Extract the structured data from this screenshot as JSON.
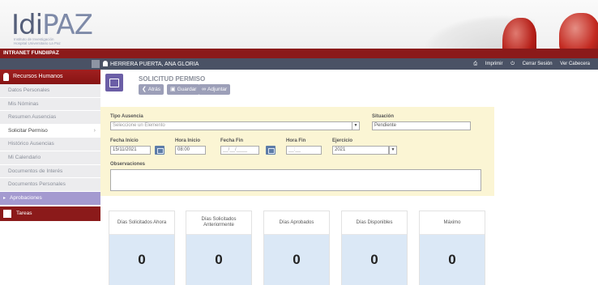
{
  "header": {
    "logo_main": "Idi",
    "logo_accent": "PAZ",
    "logo_subtitle_1": "Instituto de Investigación",
    "logo_subtitle_2": "Hospital Universitario La Paz"
  },
  "topbar": {
    "title": "INTRANET FUNDIIPAZ"
  },
  "userbar": {
    "user_name": "HERRERA PUERTA, ANA GLORIA",
    "print": "Imprimir",
    "logout": "Cerrar Sesión",
    "show_header": "Ver Cabecera"
  },
  "sidebar": {
    "section": "Recursos Humanos",
    "items": [
      {
        "label": "Datos Personales"
      },
      {
        "label": "Mis Nóminas"
      },
      {
        "label": "Resumen Ausencias"
      },
      {
        "label": "Solicitar Permiso"
      },
      {
        "label": "Histórico Ausencias"
      },
      {
        "label": "Mi Calendario"
      },
      {
        "label": "Documentos de Interés"
      },
      {
        "label": "Documentos Personales"
      }
    ],
    "aprobaciones": "Aprobaciones",
    "tareas": "Tareas"
  },
  "page": {
    "title": "SOLICITUD PERMISO",
    "buttons": {
      "back": "Atrás",
      "save": "Guardar",
      "attach": "Adjuntar"
    }
  },
  "form": {
    "tipo_label": "Tipo Ausencia",
    "tipo_value": "Seleccione un Elemento",
    "situacion_label": "Situación",
    "situacion_value": "Pendiente",
    "fecha_inicio_label": "Fecha Inicio",
    "fecha_inicio_value": "15/11/2021",
    "hora_inicio_label": "Hora Inicio",
    "hora_inicio_value": "08:00",
    "fecha_fin_label": "Fecha Fin",
    "fecha_fin_value": "__/__/____",
    "hora_fin_label": "Hora Fin",
    "hora_fin_value": "__:__",
    "ejercicio_label": "Ejercicio",
    "ejercicio_value": "2021",
    "observaciones_label": "Observaciones"
  },
  "cards": [
    {
      "title": "Días Solicitados Ahora",
      "value": "0"
    },
    {
      "title": "Días Solicitados Anteriormente",
      "value": "0"
    },
    {
      "title": "Días Aprobados",
      "value": "0"
    },
    {
      "title": "Días Disponibles",
      "value": "0"
    },
    {
      "title": "Máximo",
      "value": "0"
    }
  ],
  "colors": {
    "brand_red": "#8b1a1a",
    "purple": "#6b5ea6",
    "form_bg": "#fbf5d4",
    "card_value_bg": "#dbe8f6"
  }
}
